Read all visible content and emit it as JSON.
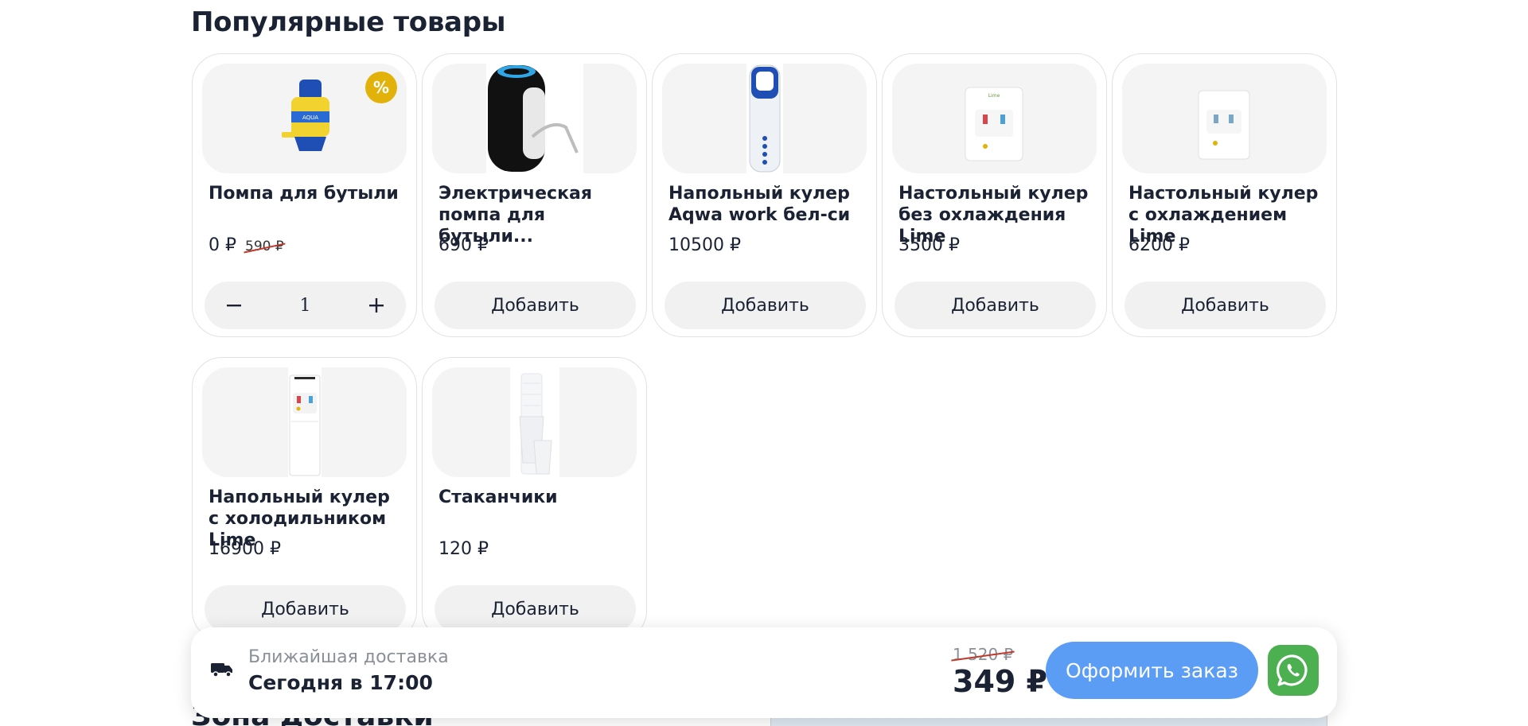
{
  "section": {
    "title": "Популярные товары"
  },
  "products": [
    {
      "name": "Помпа для бутыли",
      "price": "0 ₽",
      "old_price": "590 ₽",
      "badge": "%",
      "quantity": "1",
      "image_icon": "manual-pump-image"
    },
    {
      "name": "Электрическая помпа для бутыли...",
      "price": "690 ₽",
      "add_label": "Добавить",
      "image_icon": "electric-pump-image"
    },
    {
      "name": "Напольный кулер Aqwa work бел-си",
      "price": "10500 ₽",
      "add_label": "Добавить",
      "image_icon": "floor-cooler-image"
    },
    {
      "name": "Настольный кулер без охлаждения Lime",
      "price": "3500 ₽",
      "add_label": "Добавить",
      "image_icon": "desktop-cooler-image"
    },
    {
      "name": "Настольный кулер с охлаждением Lime",
      "price": "6200 ₽",
      "add_label": "Добавить",
      "image_icon": "desktop-cooler-cooling-image"
    },
    {
      "name": "Напольный кулер с холодильником Lime",
      "price": "16900 ₽",
      "add_label": "Добавить",
      "image_icon": "floor-cooler-fridge-image"
    },
    {
      "name": "Стаканчики",
      "price": "120 ₽",
      "add_label": "Добавить",
      "image_icon": "cups-image"
    }
  ],
  "next_section": {
    "title": "Зона доставки"
  },
  "bottom_bar": {
    "delivery_label": "Ближайшая доставка",
    "delivery_time": "Сегодня в 17:00",
    "total_old": "1 520 ₽",
    "total_new": "349 ₽",
    "order_label": "Оформить заказ"
  },
  "colors": {
    "accent": "#5b9cf4",
    "badge": "#e2b20a",
    "whatsapp": "#4caf50",
    "strike": "#c0392b"
  }
}
